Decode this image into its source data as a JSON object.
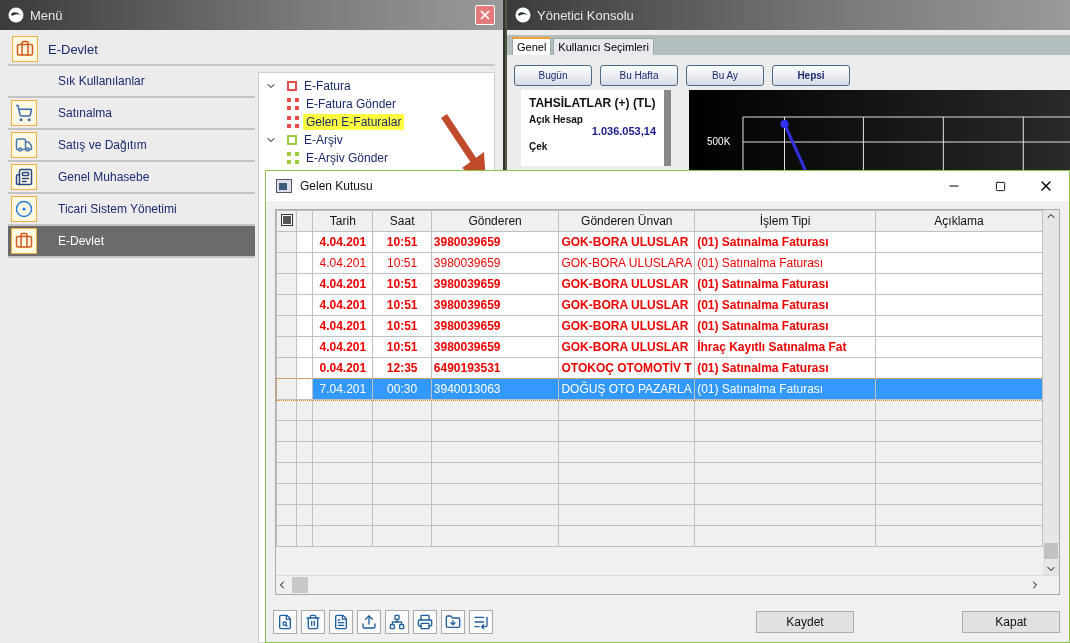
{
  "menu_window": {
    "title": "Menü",
    "header": "E-Devlet",
    "items": [
      {
        "label": "Sık Kullanılanlar",
        "kind": "none",
        "selected": false
      },
      {
        "label": "Satınalma",
        "kind": "cart",
        "selected": false
      },
      {
        "label": "Satış ve Dağıtım",
        "kind": "truck",
        "selected": false
      },
      {
        "label": "Genel Muhasebe",
        "kind": "ledger",
        "selected": false
      },
      {
        "label": "Ticari Sistem Yönetimi",
        "kind": "ring",
        "selected": false
      },
      {
        "label": "E-Devlet",
        "kind": "briefcase",
        "selected": true
      }
    ],
    "tree": [
      {
        "label": "E-Fatura",
        "color": "#e84c4c",
        "expanded": true,
        "selected": false,
        "children": [
          {
            "label": "E-Fatura Gönder",
            "color": "#e84c4c",
            "selected": false
          },
          {
            "label": "Gelen E-Faturalar",
            "color": "#e84c4c",
            "selected": true
          }
        ]
      },
      {
        "label": "E-Arşiv",
        "color": "#9ccc3c",
        "expanded": true,
        "selected": false,
        "children": [
          {
            "label": "E-Arşiv Gönder",
            "color": "#9ccc3c",
            "selected": false
          }
        ]
      }
    ]
  },
  "console_window": {
    "title": "Yönetici Konsolu",
    "tabs": [
      {
        "label": "Genel",
        "selected": true
      },
      {
        "label": "Kullanıcı Seçimleri",
        "selected": false
      }
    ],
    "period_buttons": [
      {
        "label": "Bugün",
        "selected": false
      },
      {
        "label": "Bu Hafta",
        "selected": false
      },
      {
        "label": "Bu Ay",
        "selected": false
      },
      {
        "label": "Hepsi",
        "selected": true
      }
    ],
    "summary": {
      "title": "TAHSİLATLAR (+) (TL)",
      "entries": [
        {
          "label": "Açık Hesap",
          "value": "1.036.053,14"
        },
        {
          "label": "Çek"
        }
      ]
    },
    "chart": {
      "axis_label": "500K"
    }
  },
  "dialog": {
    "title": "Gelen Kutusu",
    "select_all": {
      "indeterminate": true
    },
    "columns": [
      "Tarih",
      "Saat",
      "Gönderen",
      "Gönderen Ünvan",
      "İşlem Tipi",
      "Açıklama"
    ],
    "rows": [
      {
        "cells": [
          "4.04.201",
          "10:51",
          "3980039659",
          "GOK-BORA ULUSLAR",
          "(01) Satınalma Faturası",
          ""
        ],
        "unread": true,
        "selected": false
      },
      {
        "cells": [
          "4.04.201",
          "10:51",
          "3980039659",
          "GOK-BORA ULUSLARA",
          "(01) Satınalma Faturası",
          ""
        ],
        "unread": false,
        "selected": false
      },
      {
        "cells": [
          "4.04.201",
          "10:51",
          "3980039659",
          "GOK-BORA ULUSLAR",
          "(01) Satınalma Faturası",
          ""
        ],
        "unread": true,
        "selected": false
      },
      {
        "cells": [
          "4.04.201",
          "10:51",
          "3980039659",
          "GOK-BORA ULUSLAR",
          "(01) Satınalma Faturası",
          ""
        ],
        "unread": true,
        "selected": false
      },
      {
        "cells": [
          "4.04.201",
          "10:51",
          "3980039659",
          "GOK-BORA ULUSLAR",
          "(01) Satınalma Faturası",
          ""
        ],
        "unread": true,
        "selected": false
      },
      {
        "cells": [
          "4.04.201",
          "10:51",
          "3980039659",
          "GOK-BORA ULUSLAR",
          "İhraç Kayıtlı Satınalma Fat",
          ""
        ],
        "unread": true,
        "selected": false
      },
      {
        "cells": [
          "0.04.201",
          "12:35",
          "6490193531",
          "OTOKOÇ OTOMOTİV T",
          "(01) Satınalma Faturası",
          ""
        ],
        "unread": true,
        "selected": false
      },
      {
        "cells": [
          "7.04.201",
          "00:30",
          "3940013063",
          "DOĞUŞ OTO PAZARLA",
          "(01) Satınalma Faturası",
          ""
        ],
        "unread": false,
        "selected": true
      }
    ],
    "buttons": [
      "Kaydet",
      "Kapat"
    ]
  }
}
